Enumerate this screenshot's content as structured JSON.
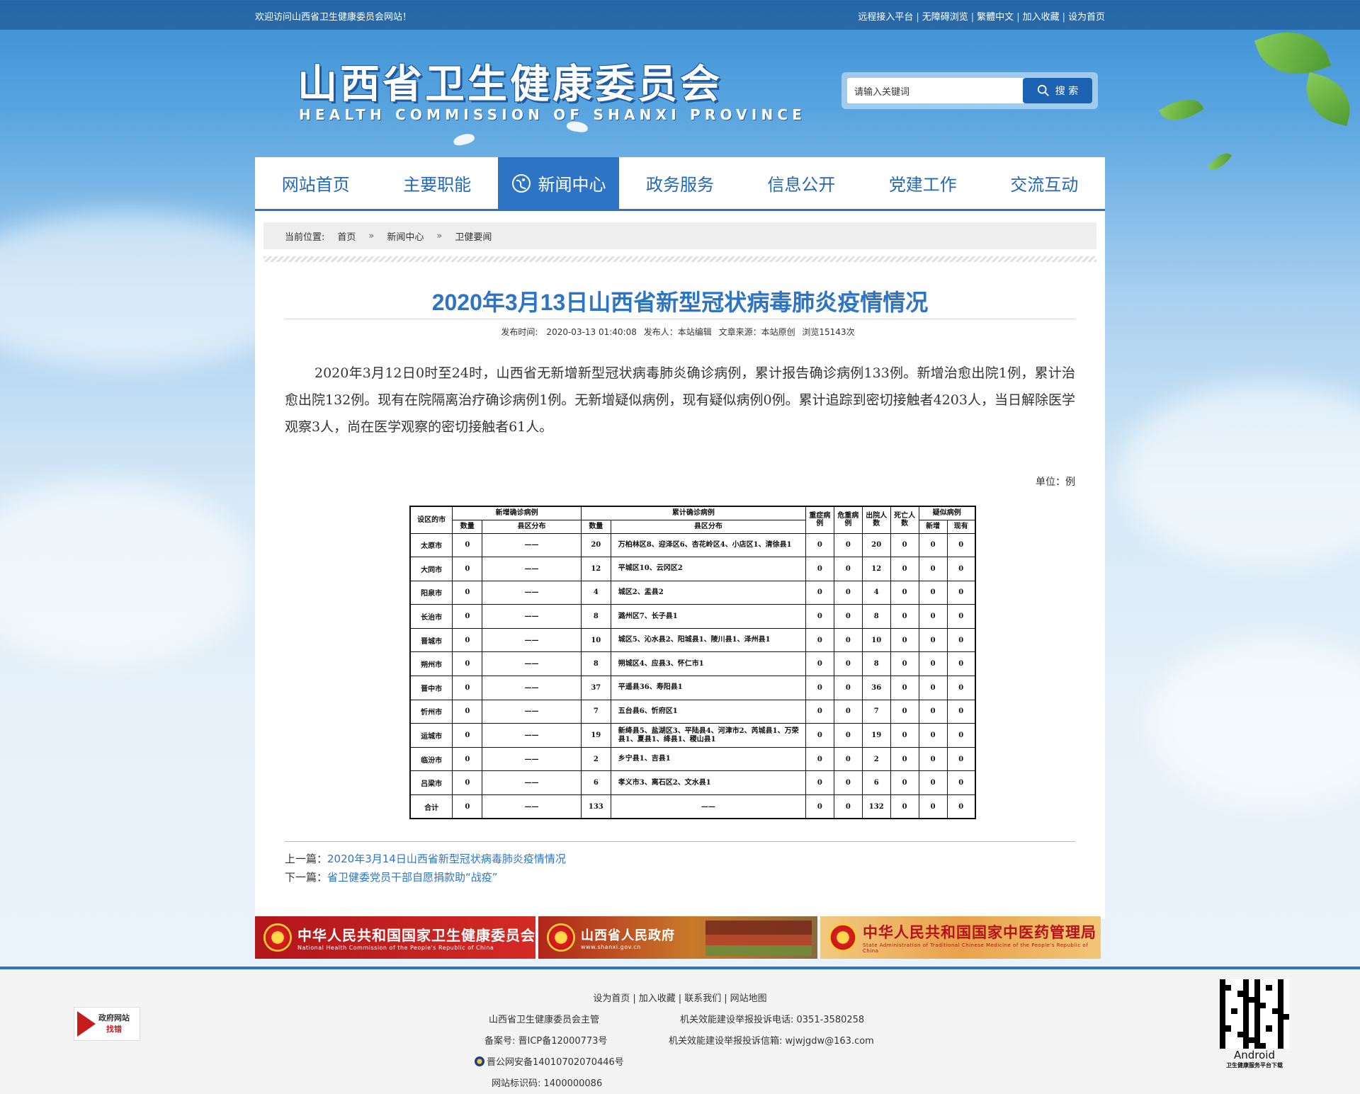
{
  "topbar": {
    "welcome": "欢迎访问山西省卫生健康委员会网站！",
    "links": [
      "远程接入平台",
      "无障碍浏览",
      "繁體中文",
      "加入收藏",
      "设为首页"
    ]
  },
  "header": {
    "logo_cn": "山西省卫生健康委员会",
    "logo_en": "HEALTH COMMISSION OF SHANXI PROVINCE",
    "search_placeholder": "请输入关键词",
    "search_button": "搜 索"
  },
  "nav": {
    "items": [
      "网站首页",
      "主要职能",
      "新闻中心",
      "政务服务",
      "信息公开",
      "党建工作",
      "交流互动"
    ],
    "active": "新闻中心"
  },
  "breadcrumb": {
    "label": "当前位置:",
    "items": [
      "首页",
      "新闻中心",
      "卫健要闻"
    ],
    "sep": "»"
  },
  "article": {
    "title": "2020年3月13日山西省新型冠状病毒肺炎疫情情况",
    "meta": {
      "publish_time": "发布时间:　2020-03-13 01:40:08",
      "publisher": "发布人：本站编辑",
      "source": "文章来源：本站原创",
      "views": "浏览15143次"
    },
    "body": "2020年3月12日0时至24时，山西省无新增新型冠状病毒肺炎确诊病例，累计报告确诊病例133例。新增治愈出院1例，累计治愈出院132例。现有在院隔离治疗确诊病例1例。无新增疑似病例，现有疑似病例0例。累计追踪到密切接触者4203人，当日解除医学观察3人，尚在医学观察的密切接触者61人。",
    "unit": "单位：例"
  },
  "table": {
    "headers": {
      "city": "设区的市",
      "new_confirmed": "新增确诊病例",
      "cumulative": "累计确诊病例",
      "severe": "重症病例",
      "critical": "危重病例",
      "discharged": "出院人数",
      "deaths": "死亡人数",
      "suspected": "疑似病例",
      "count": "数量",
      "county": "县区分布",
      "new": "新增",
      "current": "现有"
    },
    "rows": [
      [
        "太原市",
        "0",
        "——",
        "20",
        "万柏林区8、迎泽区6、杏花岭区4、小店区1、清徐县1",
        "0",
        "0",
        "20",
        "0",
        "0",
        "0"
      ],
      [
        "大同市",
        "0",
        "——",
        "12",
        "平城区10、云冈区2",
        "0",
        "0",
        "12",
        "0",
        "0",
        "0"
      ],
      [
        "阳泉市",
        "0",
        "——",
        "4",
        "城区2、盂县2",
        "0",
        "0",
        "4",
        "0",
        "0",
        "0"
      ],
      [
        "长治市",
        "0",
        "——",
        "8",
        "潞州区7、长子县1",
        "0",
        "0",
        "8",
        "0",
        "0",
        "0"
      ],
      [
        "晋城市",
        "0",
        "——",
        "10",
        "城区5、沁水县2、阳城县1、陵川县1、泽州县1",
        "0",
        "0",
        "10",
        "0",
        "0",
        "0"
      ],
      [
        "朔州市",
        "0",
        "——",
        "8",
        "朔城区4、应县3、怀仁市1",
        "0",
        "0",
        "8",
        "0",
        "0",
        "0"
      ],
      [
        "晋中市",
        "0",
        "——",
        "37",
        "平遥县36、寿阳县1",
        "0",
        "0",
        "36",
        "0",
        "0",
        "0"
      ],
      [
        "忻州市",
        "0",
        "——",
        "7",
        "五台县6、忻府区1",
        "0",
        "0",
        "7",
        "0",
        "0",
        "0"
      ],
      [
        "运城市",
        "0",
        "——",
        "19",
        "新绛县5、盐湖区3、平陆县4、河津市2、芮城县1、万荣县1、夏县1、绛县1、稷山县1",
        "0",
        "0",
        "19",
        "0",
        "0",
        "0"
      ],
      [
        "临汾市",
        "0",
        "——",
        "2",
        "乡宁县1、吉县1",
        "0",
        "0",
        "2",
        "0",
        "0",
        "0"
      ],
      [
        "吕梁市",
        "0",
        "——",
        "6",
        "孝义市3、离石区2、文水县1",
        "0",
        "0",
        "6",
        "0",
        "0",
        "0"
      ],
      [
        "合计",
        "0",
        "——",
        "133",
        "——",
        "0",
        "0",
        "132",
        "0",
        "0",
        "0"
      ]
    ]
  },
  "prevnext": {
    "prev_label": "上一篇：",
    "prev_title": "2020年3月14日山西省新型冠状病毒肺炎疫情情况",
    "next_label": "下一篇：",
    "next_title": "省卫健委党员干部自愿捐款助“战疫”"
  },
  "banners": [
    {
      "cn": "中华人民共和国国家卫生健康委员会",
      "en": "National Health Commission of the People's Republic of China"
    },
    {
      "cn": "山西省人民政府",
      "en": "www.shanxi.gov.cn"
    },
    {
      "cn": "中华人民共和国国家中医药管理局",
      "en": "State Administration of Traditional Chinese Medicine of the People's Republic of China"
    }
  ],
  "footer": {
    "links": [
      "设为首页",
      "加入收藏",
      "联系我们",
      "网站地图"
    ],
    "sponsor": "山西省卫生健康委员会主管",
    "complaint_phone": "机关效能建设举报投诉电话:  0351-3580258",
    "icp": "备案号:  晋ICP备12000773号",
    "complaint_email": "机关效能建设举报投诉信箱:  wjwjgdw@163.com",
    "police": "晋公网安备14010702070446号",
    "site_id": "网站标识码:  1400000086",
    "gov_badge_top": "政府网站",
    "gov_badge_bottom": "找错",
    "qr_label": "Android",
    "qr_sub": "卫生健康服务平台下载"
  }
}
